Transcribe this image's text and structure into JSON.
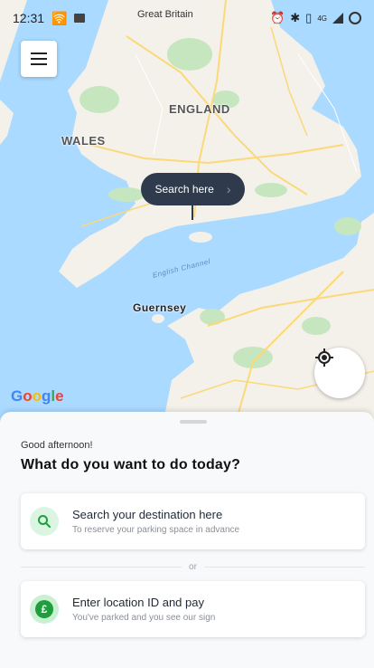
{
  "status_bar": {
    "time": "12:31",
    "top_label": "Great Britain",
    "network": "4G"
  },
  "map": {
    "labels": {
      "england": "ENGLAND",
      "wales": "WALES",
      "english_channel": "English Channel",
      "guernsey": "Guernsey"
    },
    "search_here_label": "Search here",
    "attribution": "Google",
    "attribution_colors": [
      "#4285F4",
      "#EA4335",
      "#FBBC05",
      "#4285F4",
      "#34A853",
      "#EA4335"
    ]
  },
  "icons": {
    "menu": "menu-icon",
    "locate": "my-location-icon",
    "search": "search-icon",
    "pound": "pound-coin-icon"
  },
  "colors": {
    "accent_green": "#1e9e3c",
    "search_chip": "#2f3b4c",
    "sea": "#aadaff",
    "land": "#f4f1ea",
    "park": "#c6e6c0",
    "road": "#fbd979"
  },
  "sheet": {
    "greeting": "Good afternoon!",
    "headline": "What do you want to do today?",
    "option_search": {
      "title": "Search your destination here",
      "subtitle": "To reserve your parking space in advance"
    },
    "divider_text": "or",
    "option_location": {
      "title": "Enter location ID and pay",
      "subtitle": "You've parked and you see our sign"
    }
  }
}
